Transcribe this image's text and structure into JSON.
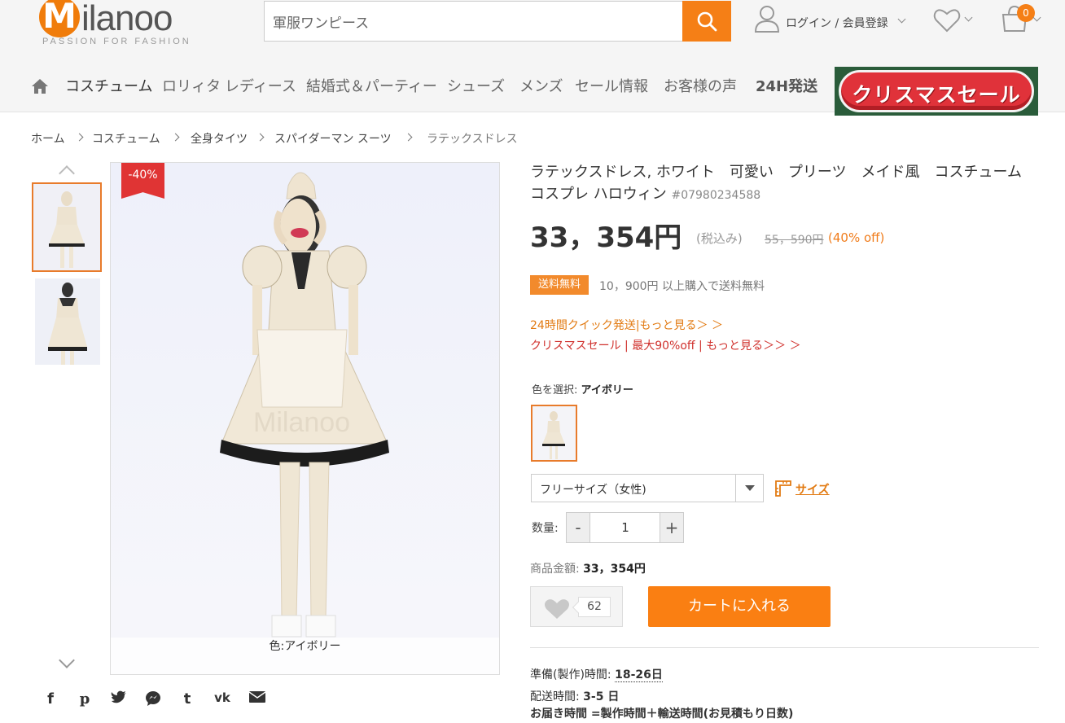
{
  "header": {
    "logo_letter": "M",
    "logo_text": "ilanoo",
    "logo_tagline": "PASSION FOR FASHION",
    "search_value": "軍服ワンピース",
    "account_label": "ログイン / 会員登録",
    "cart_count": "0",
    "accent_color": "#f57f16"
  },
  "nav": {
    "items": [
      "コスチューム",
      "ロリィタ",
      "レディース",
      "結婚式＆パーティー",
      "シューズ",
      "メンズ",
      "セール情報",
      "お客様の声",
      "24H発送"
    ],
    "banner_text": "クリスマスセール"
  },
  "breadcrumb": [
    "ホーム",
    "コスチューム",
    "全身タイツ",
    "スパイダーマン スーツ",
    "ラテックスドレス"
  ],
  "gallery": {
    "discount_badge": "-40%",
    "color_caption": "色:アイボリー",
    "watermark": "Milanoo"
  },
  "share_icons": [
    "facebook-icon",
    "pinterest-icon",
    "twitter-icon",
    "messenger-icon",
    "tumblr-icon",
    "vk-icon",
    "email-icon"
  ],
  "product": {
    "title": "ラテックスドレス, ホワイト　可愛い　プリーツ　メイド風　コスチューム　コスプレ ハロウィン",
    "sku": "#07980234588",
    "price": "33，354円",
    "tax_note": "(税込み)",
    "original_price": "55，590円",
    "discount": "(40% off)",
    "shipping_badge": "送料無料",
    "shipping_note": "10，900円 以上購入で送料無料",
    "promo_quick": "24時間クイック発送|もっと見る＞ ＞",
    "promo_sale": "クリスマスセール | 最大90%off | もっと見る＞＞ ＞",
    "color_label": "色を選択:",
    "color_value": "アイボリー",
    "size_value": "フリーサイズ（女性)",
    "size_guide": "サイズ",
    "qty_label": "数量:",
    "qty_value": "1",
    "minus": "-",
    "plus": "+",
    "subtotal_label": "商品金額:",
    "subtotal_value": "33，354円",
    "fav_count": "62",
    "cart_button": "カートに入れる",
    "prep_label": "準備(製作)時間:",
    "prep_value": "18-26日",
    "ship_label": "配送時間:",
    "ship_value": "3-5 日",
    "delivery_formula": "お届き時間 =製作時間＋輸送時間(お見積もり日数)"
  }
}
